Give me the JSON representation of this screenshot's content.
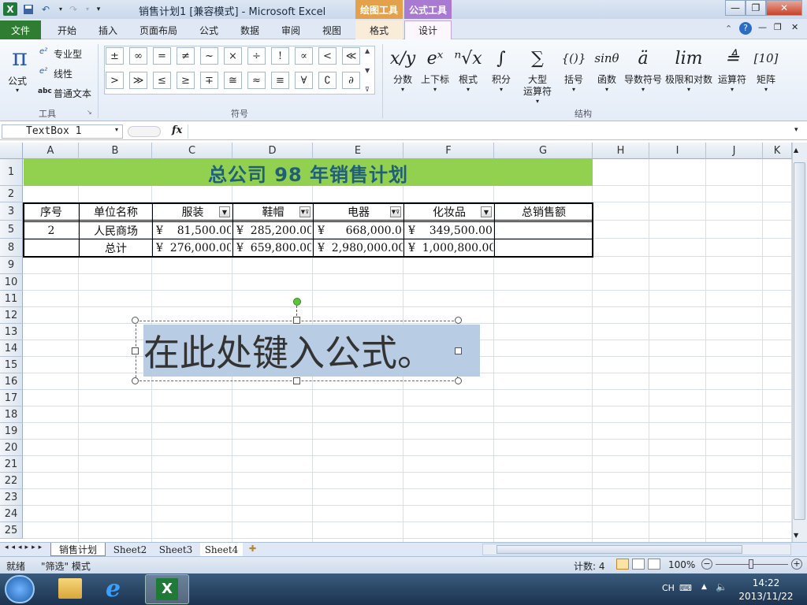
{
  "window": {
    "title": "销售计划1  [兼容模式]  -  Microsoft Excel",
    "context_tab_drawing": "绘图工具",
    "context_tab_formula": "公式工具",
    "minimize": "—",
    "restore": "❐",
    "close": "✕"
  },
  "ribbon_tabs": [
    "文件",
    "开始",
    "插入",
    "页面布局",
    "公式",
    "数据",
    "审阅",
    "视图",
    "格式",
    "设计"
  ],
  "tools_group": {
    "formula_label": "公式",
    "professional": "专业型",
    "linear": "线性",
    "normal_text": "普通文本",
    "group_label": "工具"
  },
  "symbols_group": {
    "row1": [
      "±",
      "∞",
      "=",
      "≠",
      "~",
      "×",
      "÷",
      "!",
      "∝",
      "<",
      "≪"
    ],
    "row2": [
      ">",
      "≫",
      "≤",
      "≥",
      "∓",
      "≅",
      "≈",
      "≡",
      "∀",
      "∁",
      "∂"
    ],
    "group_label": "符号"
  },
  "structures_group": {
    "items": [
      {
        "label": "分数",
        "glyph": "x/y"
      },
      {
        "label": "上下标",
        "glyph": "eˣ"
      },
      {
        "label": "根式",
        "glyph": "ⁿ√x"
      },
      {
        "label": "积分",
        "glyph": "∫"
      },
      {
        "label": "大型\n运算符",
        "glyph": "∑"
      },
      {
        "label": "括号",
        "glyph": "{()}"
      },
      {
        "label": "函数",
        "glyph": "sinθ"
      },
      {
        "label": "导数符号",
        "glyph": "ä"
      },
      {
        "label": "极限和对数",
        "glyph": "lim"
      },
      {
        "label": "运算符",
        "glyph": "≜"
      },
      {
        "label": "矩阵",
        "glyph": "[10]"
      }
    ],
    "group_label": "结构"
  },
  "formula_bar": {
    "name_box": "TextBox 1",
    "fx": "fx",
    "content": ""
  },
  "grid": {
    "columns": [
      "A",
      "B",
      "C",
      "D",
      "E",
      "F",
      "G",
      "H",
      "I",
      "J",
      "K"
    ],
    "rows": [
      "1",
      "2",
      "3",
      "5",
      "8",
      "9",
      "10",
      "11",
      "12",
      "13",
      "14",
      "15",
      "16",
      "17",
      "18",
      "19",
      "20",
      "21",
      "22",
      "23",
      "24",
      "25"
    ],
    "title": "总公司  98  年销售计划",
    "headers": [
      "序号",
      "单位名称",
      "服装",
      "鞋帽",
      "电器",
      "化妆品",
      "总销售额"
    ],
    "row5": {
      "a": "2",
      "b": "人民商场",
      "c": "¥    81,500.00",
      "d": "¥  285,200.00",
      "e": "¥      668,000.00",
      "f": "¥    349,500.00",
      "g": ""
    },
    "row8": {
      "a": "",
      "b": "总计",
      "c": "¥  276,000.00",
      "d": "¥  659,800.00",
      "e": "¥  2,980,000.00",
      "f": "¥  1,000,800.00",
      "g": ""
    }
  },
  "textbox": {
    "text": "在此处键入公式。"
  },
  "sheet_tabs": [
    "销售计划",
    "Sheet2",
    "Sheet3",
    "Sheet4"
  ],
  "status": {
    "ready": "就绪",
    "filter_mode": "\"筛选\" 模式",
    "count": "计数: 4",
    "zoom": "100%"
  },
  "taskbar": {
    "lang": "CH",
    "time": "14:22",
    "date": "2013/11/22"
  },
  "colors": {
    "title_fill": "#92d050",
    "title_text": "#1f5f7a",
    "file_tab": "#2e7d32",
    "drawing_tab": "#e79a3a",
    "formula_tab": "#9b6fc7"
  }
}
